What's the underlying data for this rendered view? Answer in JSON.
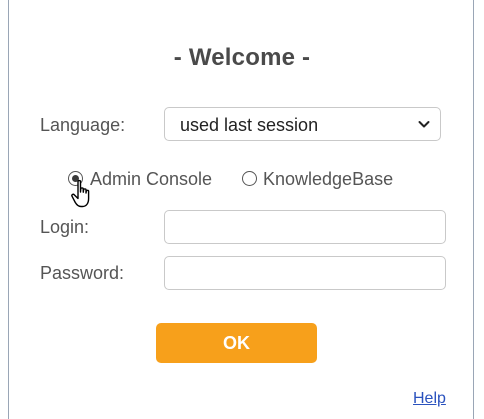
{
  "dialog": {
    "title": "- Welcome -"
  },
  "language": {
    "label": "Language:",
    "selected": "used last session"
  },
  "mode": {
    "options": [
      {
        "label": "Admin Console",
        "checked": true
      },
      {
        "label": "KnowledgeBase",
        "checked": false
      }
    ]
  },
  "login": {
    "label": "Login:",
    "value": ""
  },
  "password": {
    "label": "Password:",
    "value": ""
  },
  "actions": {
    "ok_label": "OK",
    "help_label": "Help"
  },
  "colors": {
    "accent": "#f7a01b",
    "link": "#2a52be",
    "border": "#9aa6b6"
  },
  "icons": {
    "select_arrow": "chevron-down-icon",
    "pointer": "hand-pointer-icon"
  }
}
